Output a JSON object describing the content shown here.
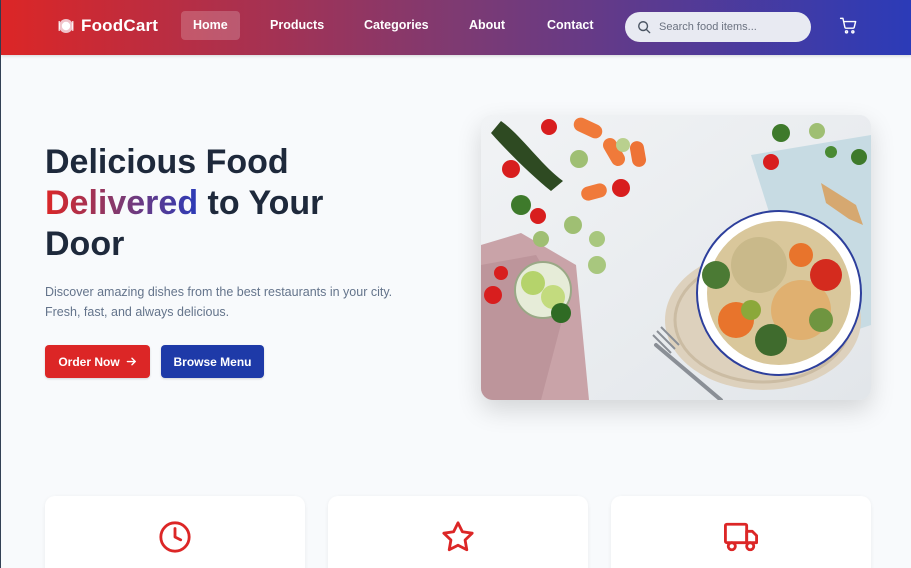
{
  "brand": {
    "name": "FoodCart",
    "icon": "plate-icon"
  },
  "nav": {
    "links": [
      {
        "label": "Home",
        "active": true
      },
      {
        "label": "Products",
        "active": false
      },
      {
        "label": "Categories",
        "active": false
      },
      {
        "label": "About",
        "active": false
      },
      {
        "label": "Contact",
        "active": false
      }
    ],
    "search_placeholder": "Search food items...",
    "cart_icon": "shopping-cart-icon"
  },
  "hero": {
    "title_line1": "Delicious Food",
    "title_accent": "Delivered",
    "title_rest": " to Your",
    "title_line3": "Door",
    "description": "Discover amazing dishes from the best restaurants in your city. Fresh, fast, and always delicious.",
    "order_button": "Order Now",
    "browse_button": "Browse Menu"
  },
  "features": [
    {
      "icon": "clock-icon"
    },
    {
      "icon": "star-icon"
    },
    {
      "icon": "truck-icon"
    }
  ],
  "colors": {
    "primary_red": "#dc2626",
    "primary_blue": "#1e3aa8",
    "gradient_mid": "#7e3a72",
    "text_dark": "#1e293b",
    "text_muted": "#64748b"
  }
}
